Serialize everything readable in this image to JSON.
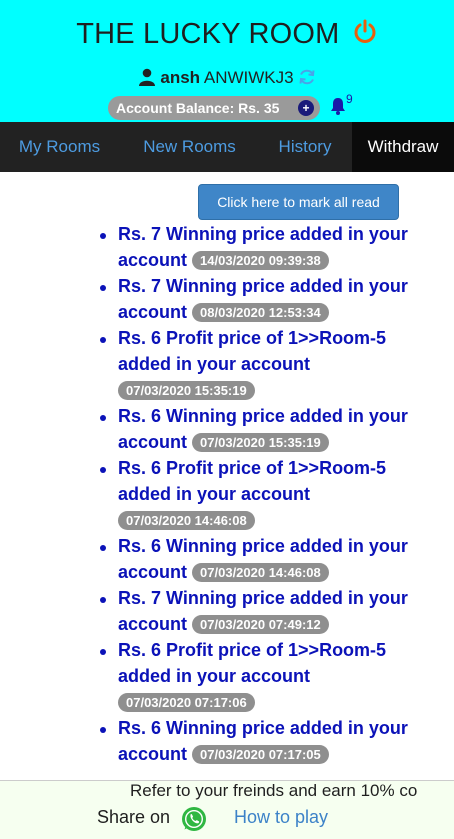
{
  "header": {
    "title": "THE LUCKY ROOM",
    "username": "ansh",
    "user_code": "ANWIWKJ3",
    "balance_label": "Account Balance: Rs. 35",
    "plus_symbol": "+",
    "notification_count": "9",
    "bg_color": "#00ffff",
    "power_color": "#e8600c"
  },
  "nav": {
    "items": [
      {
        "label": "My Rooms"
      },
      {
        "label": "New Rooms"
      },
      {
        "label": "History"
      },
      {
        "label": "Withdraw"
      }
    ],
    "active": "Withdraw"
  },
  "actions": {
    "mark_all_read": "Click here to mark all read"
  },
  "notifications": [
    {
      "text": "Rs. 7 Winning price added in your account",
      "time": "14/03/2020 09:39:38"
    },
    {
      "text": "Rs. 7 Winning price added in your account",
      "time": "08/03/2020 12:53:34"
    },
    {
      "text": "Rs. 6 Profit price of 1>>Room-5 added in your account",
      "time": "07/03/2020 15:35:19"
    },
    {
      "text": "Rs. 6 Winning price added in your account",
      "time": "07/03/2020 15:35:19"
    },
    {
      "text": "Rs. 6 Profit price of 1>>Room-5 added in your account",
      "time": "07/03/2020 14:46:08"
    },
    {
      "text": "Rs. 6 Winning price added in your account",
      "time": "07/03/2020 14:46:08"
    },
    {
      "text": "Rs. 7 Winning price added in your account",
      "time": "07/03/2020 07:49:12"
    },
    {
      "text": "Rs. 6 Profit price of 1>>Room-5 added in your account",
      "time": "07/03/2020 07:17:06"
    },
    {
      "text": "Rs. 6 Winning price added in your account",
      "time": "07/03/2020 07:17:05"
    }
  ],
  "footer": {
    "marquee": "Refer to your freinds and earn 10% co",
    "share_label": "Share on",
    "how_to_play": "How to play"
  }
}
